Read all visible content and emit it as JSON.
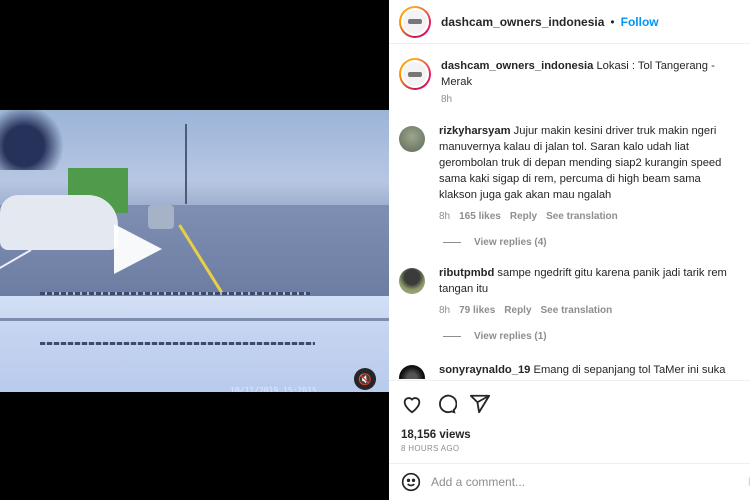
{
  "post": {
    "author": "dashcam_owners_indonesia",
    "separator": "•",
    "follow_label": "Follow",
    "caption": {
      "username": "dashcam_owners_indonesia",
      "text": " Lokasi : Tol Tangerang - Merak",
      "time": "8h"
    },
    "video": {
      "timestamp_overlay": "10/11/2019 15:2015",
      "play_icon": "play-icon",
      "mute_icon": "speaker-muted-icon"
    }
  },
  "comments": [
    {
      "username": "rizkyharsyam",
      "text": " Jujur makin kesini driver truk makin ngeri manuvernya kalau di jalan tol. Saran kalo udah liat gerombolan truk di depan mending siap2 kurangin speed sama kaki sigap di rem, percuma di high beam sama klakson juga gak akan mau ngalah",
      "time": "8h",
      "likes": "165 likes",
      "reply_label": "Reply",
      "translate_label": "See translation",
      "view_replies": "View replies (4)"
    },
    {
      "username": "ributpmbd",
      "text": " sampe ngedrift gitu karena panik jadi tarik rem tangan itu",
      "time": "8h",
      "likes": "79 likes",
      "reply_label": "Reply",
      "translate_label": "See translation",
      "view_replies": "View replies (1)"
    },
    {
      "username": "sonyraynaldo_19",
      "text": " Emang di sepanjang tol TaMer ini suka banyak optimus prime yang ngawur. Mulai dari suka parkir di bahu jalan, jalan di lajur kanan padahal lajur kiri kosong, sampe"
    }
  ],
  "actions": {
    "icons": [
      "heart-icon",
      "comment-icon",
      "share-icon"
    ],
    "views": "18,156 views",
    "posted": "8 HOURS AGO"
  },
  "add_comment": {
    "placeholder": "Add a comment...",
    "post_label": "P",
    "emoji_icon": "smiley-icon"
  }
}
